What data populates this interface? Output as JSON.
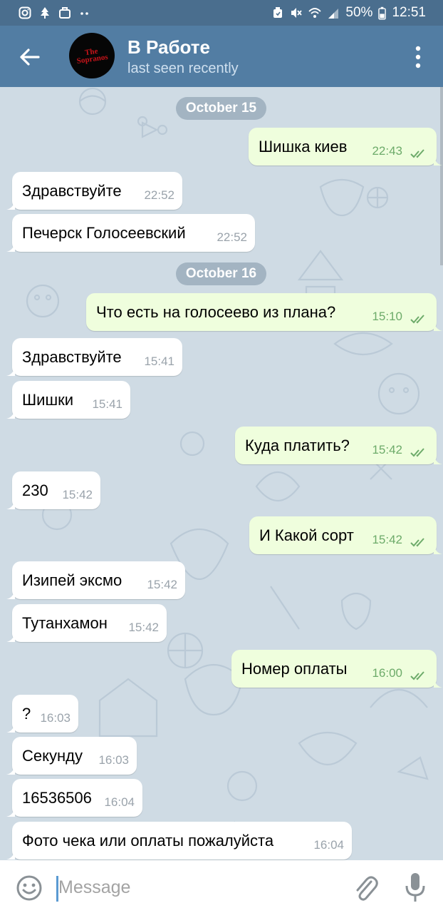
{
  "status_bar": {
    "battery": "50%",
    "time": "12:51",
    "left_icons": [
      "instagram-icon",
      "tree-icon",
      "briefcase-icon",
      "dots-icon"
    ],
    "right_icons": [
      "alarm-icon",
      "mute-icon",
      "wifi-icon",
      "signal-icon",
      "battery-icon"
    ]
  },
  "header": {
    "title": "В Работе",
    "status": "last seen recently",
    "avatar_text": "The Sopranos"
  },
  "colors": {
    "header": "#527da3",
    "status_bar": "#4a6e8e",
    "outgoing_bubble": "#effedd",
    "incoming_bubble": "#ffffff",
    "wallpaper": "#cfdbe4",
    "read_check": "#6dab6a"
  },
  "messages": [
    {
      "type": "date",
      "text": "October 15"
    },
    {
      "type": "out",
      "text": "Шишка киев",
      "time": "22:43"
    },
    {
      "type": "in",
      "text": "Здравствуйте",
      "time": "22:52"
    },
    {
      "type": "in",
      "text": "Печерск Голосеевский",
      "time": "22:52"
    },
    {
      "type": "date",
      "text": "October 16"
    },
    {
      "type": "out",
      "text": "Что есть на голосеево из плана?",
      "time": "15:10"
    },
    {
      "type": "in",
      "text": "Здравствуйте",
      "time": "15:41"
    },
    {
      "type": "in",
      "text": "Шишки",
      "time": "15:41"
    },
    {
      "type": "out",
      "text": "Куда платить?",
      "time": "15:42"
    },
    {
      "type": "in",
      "text": "230",
      "time": "15:42"
    },
    {
      "type": "out",
      "text": "И Какой сорт",
      "time": "15:42"
    },
    {
      "type": "in",
      "text": "Изипей эксмо",
      "time": "15:42"
    },
    {
      "type": "in",
      "text": "Тутанхамон",
      "time": "15:42"
    },
    {
      "type": "out",
      "text": "Номер оплаты",
      "time": "16:00"
    },
    {
      "type": "in",
      "text": "?",
      "time": "16:03"
    },
    {
      "type": "in",
      "text": "Секунду",
      "time": "16:03"
    },
    {
      "type": "in",
      "text": "16536506",
      "time": "16:04"
    },
    {
      "type": "in",
      "text": "Фото чека или оплаты пожалуйста",
      "time": "16:04"
    }
  ],
  "input": {
    "placeholder": "Message",
    "value": ""
  }
}
